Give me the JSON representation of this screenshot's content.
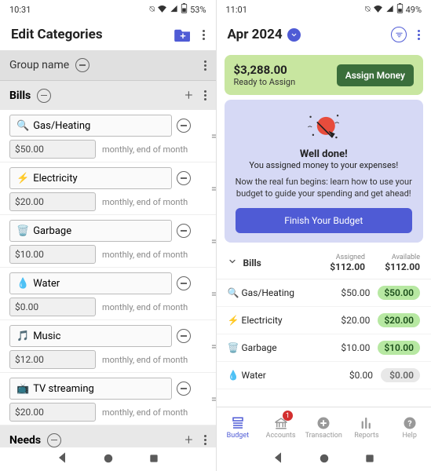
{
  "left": {
    "status": {
      "time": "10:31",
      "battery": "53%"
    },
    "title": "Edit Categories",
    "group_placeholder": "Group name",
    "groups": [
      {
        "name": "Bills",
        "items": [
          {
            "icon": "🔍",
            "name": "Gas/Heating",
            "amount": "$50.00",
            "freq": "monthly, end of month"
          },
          {
            "icon": "⚡",
            "name": "Electricity",
            "amount": "$20.00",
            "freq": "monthly, end of month"
          },
          {
            "icon": "🗑️",
            "name": "Garbage",
            "amount": "$10.00",
            "freq": "monthly, end of month"
          },
          {
            "icon": "💧",
            "name": "Water",
            "amount": "$0.00",
            "freq": "monthly, end of month"
          },
          {
            "icon": "🎵",
            "name": "Music",
            "amount": "$12.00",
            "freq": "monthly, end of month"
          },
          {
            "icon": "📺",
            "name": "TV streaming",
            "amount": "$20.00",
            "freq": "monthly, end of month"
          }
        ]
      },
      {
        "name": "Needs",
        "items": []
      }
    ]
  },
  "right": {
    "status": {
      "time": "11:01",
      "battery": "49%"
    },
    "month": "Apr 2024",
    "assign": {
      "amount": "$3,288.00",
      "subtitle": "Ready to Assign",
      "button": "Assign Money"
    },
    "welldone": {
      "title": "Well done!",
      "subtitle": "You assigned money to your expenses!",
      "text": "Now the real fun begins: learn how to use your budget to guide your spending and get ahead!",
      "cta": "Finish Your Budget"
    },
    "section": {
      "name": "Bills",
      "assigned_label": "Assigned",
      "available_label": "Available",
      "assigned": "$112.00",
      "available": "$112.00",
      "rows": [
        {
          "icon": "🔍",
          "name": "Gas/Heating",
          "assigned": "$50.00",
          "available": "$50.00",
          "zero": false
        },
        {
          "icon": "⚡",
          "name": "Electricity",
          "assigned": "$20.00",
          "available": "$20.00",
          "zero": false
        },
        {
          "icon": "🗑️",
          "name": "Garbage",
          "assigned": "$10.00",
          "available": "$10.00",
          "zero": false
        },
        {
          "icon": "💧",
          "name": "Water",
          "assigned": "$0.00",
          "available": "$0.00",
          "zero": true
        }
      ]
    },
    "tabs": [
      {
        "label": "Budget",
        "active": true,
        "badge": ""
      },
      {
        "label": "Accounts",
        "active": false,
        "badge": "1"
      },
      {
        "label": "Transaction",
        "active": false,
        "badge": ""
      },
      {
        "label": "Reports",
        "active": false,
        "badge": ""
      },
      {
        "label": "Help",
        "active": false,
        "badge": ""
      }
    ]
  }
}
